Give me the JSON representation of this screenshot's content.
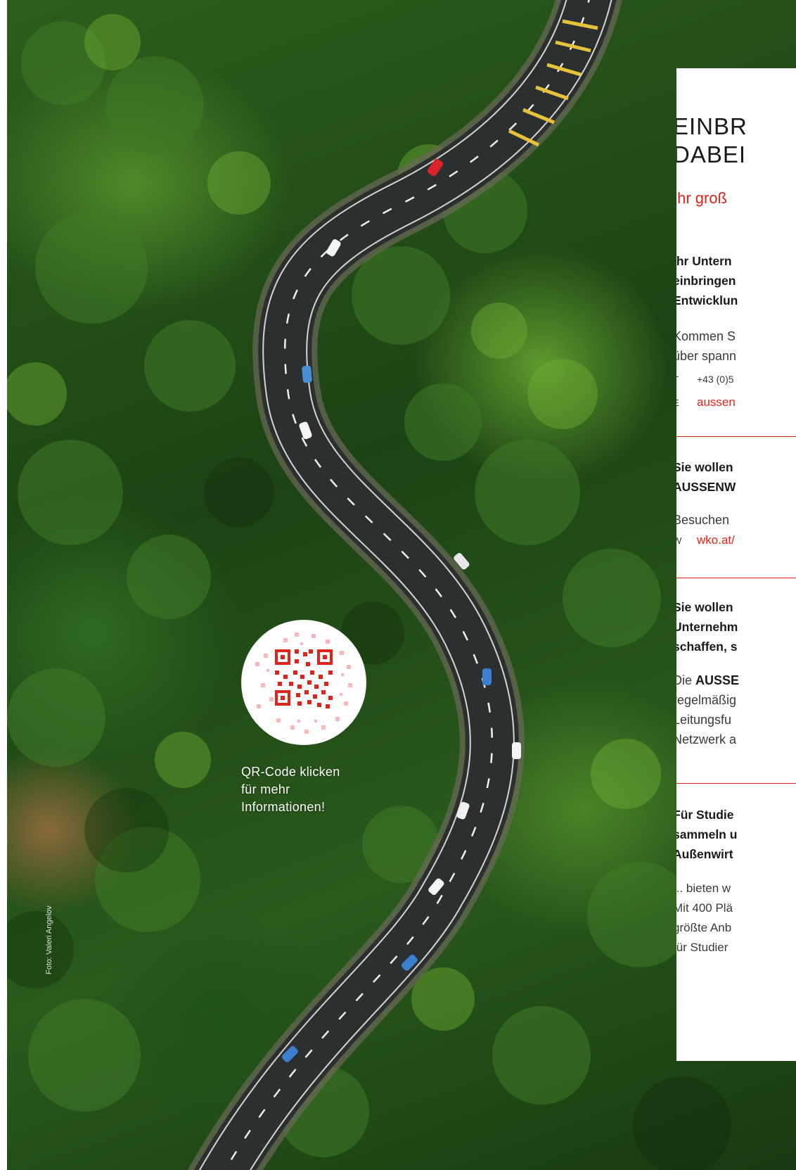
{
  "photo": {
    "credit": "Foto: Valeri Angelov"
  },
  "qr": {
    "caption_lines": [
      "QR-Code klicken",
      "für mehr",
      "Informationen!"
    ]
  },
  "panel": {
    "title_lines": [
      "EINBR",
      "DABEI"
    ],
    "subtitle": "Ihr groß",
    "section1": {
      "lead_lines": [
        "Ihr Untern",
        "einbringen",
        "Entwicklun"
      ],
      "body_lines": [
        "Kommen S",
        "über spann"
      ],
      "phone_key": "T",
      "phone": "+43 (0)5",
      "email_key": "E",
      "email": "aussen"
    },
    "section2": {
      "lead_lines": [
        "Sie wollen",
        "AUSSENW"
      ],
      "body_lines": [
        "Besuchen"
      ],
      "web_key": "W",
      "web": "wko.at/"
    },
    "section3": {
      "lead_lines": [
        "Sie wollen",
        "Unternehm",
        "schaffen, s"
      ],
      "body_first_prefix": "Die ",
      "body_first_bold": "AUSSE",
      "body_lines": [
        "regelmäßig",
        "Leitungsfu",
        "Netzwerk a"
      ]
    },
    "section4": {
      "lead_lines": [
        "Für Studie",
        "sammeln u",
        "Außenwirt"
      ],
      "body_lines": [
        "... bieten w",
        "Mit 400 Plä",
        "größte Anb",
        "für Studier"
      ]
    }
  },
  "colors": {
    "accent": "#e2231a",
    "text": "#1a1a1a"
  }
}
